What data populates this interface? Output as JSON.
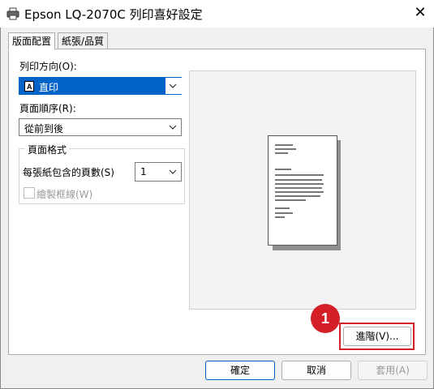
{
  "window": {
    "title": "Epson LQ-2070C 列印喜好設定",
    "close_glyph": "✕"
  },
  "tabs": [
    {
      "label": "版面配置"
    },
    {
      "label": "紙張/品質"
    }
  ],
  "orientation": {
    "label": "列印方向(O):",
    "value": "直印"
  },
  "page_order": {
    "label": "頁面順序(R):",
    "value": "從前到後"
  },
  "page_format": {
    "group_title": "頁面格式",
    "pages_per_sheet_label": "每張紙包含的頁數(S)",
    "pages_per_sheet_value": "1",
    "draw_borders_label": "繪製框線(W)",
    "draw_borders_checked": false
  },
  "buttons": {
    "advanced": "進階(V)...",
    "ok": "確定",
    "cancel": "取消",
    "apply": "套用(A)"
  },
  "annotation": {
    "number": "1",
    "color": "#d41f27"
  }
}
